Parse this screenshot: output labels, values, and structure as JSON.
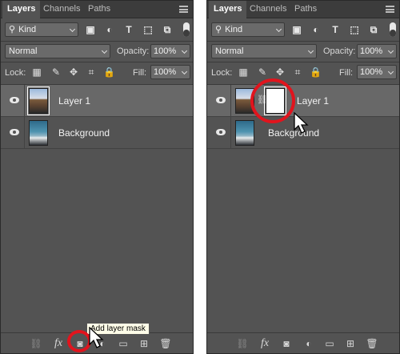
{
  "tabs": [
    "Layers",
    "Channels",
    "Paths"
  ],
  "filter": {
    "kind_label": "Kind",
    "icons": [
      "pixel-layer-filter-icon",
      "adjustment-layer-filter-icon",
      "type-layer-filter-icon",
      "shape-layer-filter-icon",
      "smart-object-filter-icon",
      "filter-toggle-icon"
    ]
  },
  "blend": {
    "mode": "Normal",
    "opacity_label": "Opacity:",
    "opacity_value": "100%"
  },
  "lock": {
    "label": "Lock:",
    "fill_label": "Fill:",
    "fill_value": "100%"
  },
  "left_panel": {
    "layers": [
      {
        "name": "Layer 1",
        "selected": true
      },
      {
        "name": "Background",
        "selected": false
      }
    ],
    "tooltip": "Add layer mask"
  },
  "right_panel": {
    "layers": [
      {
        "name": "Layer 1",
        "selected": true,
        "has_mask": true
      },
      {
        "name": "Background",
        "selected": false
      }
    ]
  },
  "bottom_icons": [
    "link-layers-icon",
    "fx-icon",
    "add-mask-icon",
    "adjustment-icon",
    "group-folder-icon",
    "new-layer-icon",
    "trash-icon"
  ],
  "icons_glyphs": {
    "fx": "fx",
    "link": "⛓",
    "trash": "🗑"
  },
  "colors": {
    "highlight": "#e1141d",
    "panel_bg": "#535353",
    "selected_row": "#686868",
    "tooltip_bg": "#fffde8"
  }
}
